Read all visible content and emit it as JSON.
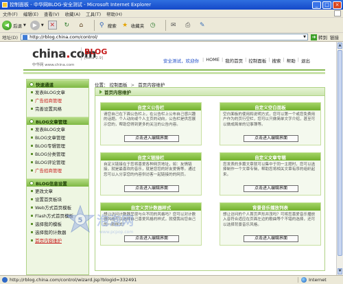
{
  "window": {
    "title": "控制面板 - 中华网BLOG-安全测试 - Microsoft Internet Explorer",
    "min": "_",
    "max": "□",
    "close": "×"
  },
  "menu": [
    "文件(F)",
    "编辑(E)",
    "查看(V)",
    "收藏(A)",
    "工具(T)",
    "帮助(H)"
  ],
  "toolbar": {
    "back": "后退",
    "search": "搜索",
    "favorites": "收藏夹"
  },
  "address": {
    "label": "地址(D)",
    "url": "http://rblog.china.com/control/",
    "go": "转到",
    "links": "链接"
  },
  "site": {
    "logo_text": "china",
    "logo_dot": ".",
    "logo_com": "com",
    "logo_sub": "中华网 www.china.com",
    "blog": "BLOG",
    "version": "[beta 2.9]",
    "user": "安全测试",
    "welcome": "，欢迎你",
    "nav": [
      "HOME",
      "我的首页",
      "控制面板",
      "搜索",
      "帮助",
      "退出"
    ]
  },
  "sidebar": {
    "groups": [
      {
        "title": "快速通道",
        "items": [
          {
            "label": "发表BLOG文章",
            "style": ""
          },
          {
            "label": "广告招商管理",
            "style": "red"
          },
          {
            "label": "完善设置风格",
            "style": ""
          }
        ]
      },
      {
        "title": "BLOG文章管理",
        "items": [
          {
            "label": "发表BLOG文章",
            "style": ""
          },
          {
            "label": "BLOG文章管理",
            "style": ""
          },
          {
            "label": "BLOG专辑管理",
            "style": ""
          },
          {
            "label": "BLOG分类管理",
            "style": ""
          },
          {
            "label": "BLOG评论管理",
            "style": ""
          },
          {
            "label": "广告招商管理",
            "style": "red"
          }
        ]
      },
      {
        "title": "BLOG信息设置",
        "items": [
          {
            "label": "更改文章",
            "style": ""
          },
          {
            "label": "设置首页板块",
            "style": ""
          },
          {
            "label": "Web方式首页模板",
            "style": ""
          },
          {
            "label": "Flash方式首页模板",
            "style": ""
          },
          {
            "label": "选择我的模板",
            "style": ""
          },
          {
            "label": "选择我的计数器",
            "style": ""
          },
          {
            "label": "首页内容维护",
            "style": "cur"
          }
        ]
      }
    ]
  },
  "breadcrumb": {
    "label": "位置：",
    "items": [
      "控制面板",
      "首页内容维护"
    ]
  },
  "main": {
    "title": "首页内容维护",
    "cards": [
      {
        "title": "自定义公告栏",
        "body": "请您自己在下面公告栏上，在公告栏上公布自己感兴趣的话题。个人动向或个人主页的动向，公告栏是供您展示您的，帮助您得到更多的关注的公告内容。",
        "button": "点击进入编辑界面"
      },
      {
        "title": "自定义空白面板",
        "body": "空白面板的使用和说明方式，您可以第一个或您免费用户作为的页行空栏，您可以只做简单文字介绍，甚至可以做成简单的记事簿等。",
        "button": "点击进入编辑界面"
      },
      {
        "title": "自定义链接栏",
        "body": "自定义链接在于您将喜爱各种网页地址，如：友情链接，就是最喜欢的音乐，就是您您的好友爱情等。通过您可以入分享您的内容供访客一起链接的的网页。",
        "button": "点击进入编辑界面"
      },
      {
        "title": "自定义文章专辑",
        "body": "您发表的多篇文章就可以集中于同一主题时，您可以选择制作一个文章专辑，帮助您将相关文章有序的组织起来。",
        "button": "点击进入编辑界面"
      },
      {
        "title": "自定义页计数器样式",
        "body": "想让访问计数器呈现与众不同的风格吗？您可以对计数器风格可以选择自己喜爱风格的样式，就使我出您自己的一款样式！",
        "button": "点击进入编辑界面"
      },
      {
        "title": "背景音乐播放列表",
        "body": "想让访问的个人首页声形并茂吗？可将您喜爱音乐播放入音符合适应在页面左边的歌曲等个不错的选择，还可以选择背景音乐风格。",
        "button": "点击进入编辑界面"
      }
    ]
  },
  "status": {
    "text": "http://rblog.china.com/control/wizard.jsp?blogid=332491",
    "zone": "Internet"
  },
  "watermark": {
    "text": "泡泡网",
    "sub": "www.pcpop.com",
    "num": "5"
  }
}
